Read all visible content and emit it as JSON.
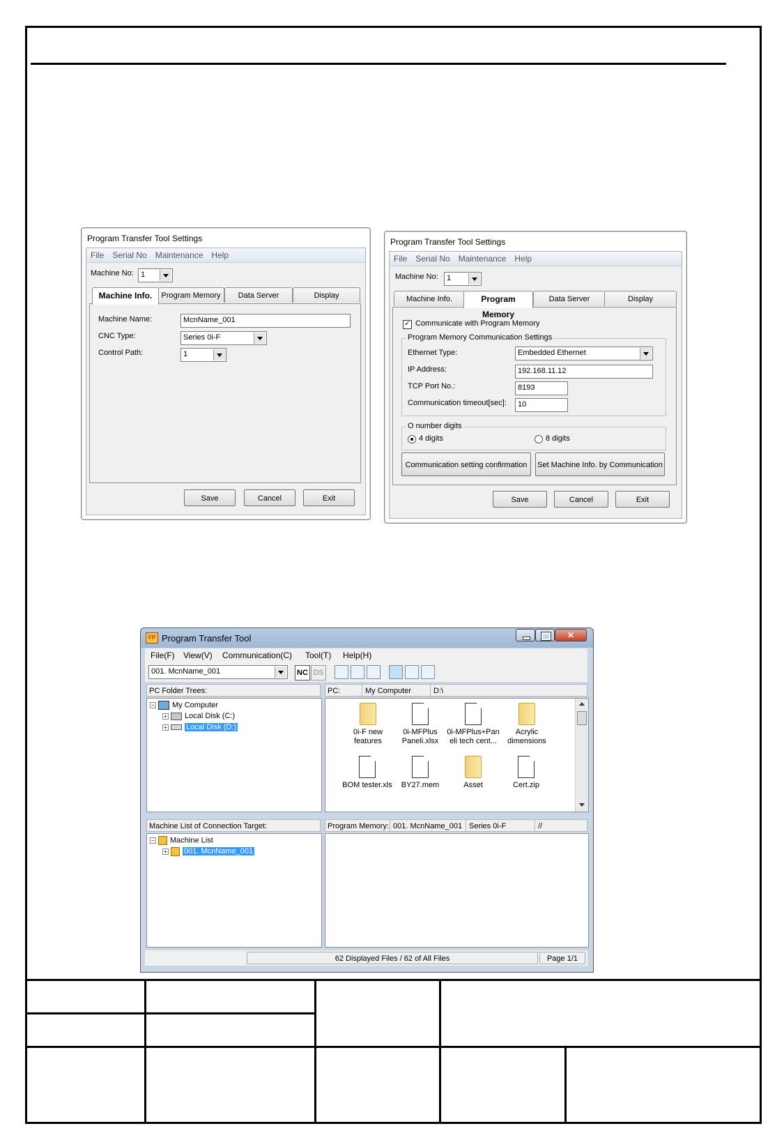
{
  "dialog_left": {
    "title": "Program Transfer Tool Settings",
    "menu": [
      "File",
      "Serial No",
      "Maintenance",
      "Help"
    ],
    "machine_no_label": "Machine No:",
    "machine_no_value": "1",
    "tabs": [
      "Machine Info.",
      "Program Memory",
      "Data Server",
      "Display"
    ],
    "machine_name_label": "Machine Name:",
    "machine_name_value": "McnName_001",
    "cnc_type_label": "CNC Type:",
    "cnc_type_value": "Series 0i-F",
    "control_path_label": "Control Path:",
    "control_path_value": "1",
    "buttons": {
      "save": "Save",
      "cancel": "Cancel",
      "exit": "Exit"
    }
  },
  "dialog_right": {
    "title": "Program Transfer Tool Settings",
    "menu": [
      "File",
      "Serial No",
      "Maintenance",
      "Help"
    ],
    "machine_no_label": "Machine No:",
    "machine_no_value": "1",
    "tabs": [
      "Machine Info.",
      "Program Memory",
      "Data Server",
      "Display"
    ],
    "communicate_label": "Communicate with Program Memory",
    "communicate_checked": true,
    "group_comm_title": "Program Memory Communication Settings",
    "ethernet_type_label": "Ethernet Type:",
    "ethernet_type_value": "Embedded Ethernet",
    "ip_label": "IP Address:",
    "ip_value": "192.168.11.12",
    "tcp_label": "TCP Port No.:",
    "tcp_value": "8193",
    "timeout_label": "Communication timeout[sec]:",
    "timeout_value": "10",
    "group_onum_title": "O number digits",
    "radio_4": "4 digits",
    "radio_8": "8 digits",
    "radio_selected": "4 digits",
    "btn_confirm": "Communication setting confirmation",
    "btn_set_info": "Set Machine Info. by Communication",
    "buttons": {
      "save": "Save",
      "cancel": "Cancel",
      "exit": "Exit"
    }
  },
  "main_window": {
    "title": "Program Transfer Tool",
    "menu": [
      "File(F)",
      "View(V)",
      "Communication(C)",
      "Tool(T)",
      "Help(H)"
    ],
    "machine_select": "001. McnName_001",
    "nc_label": "NC",
    "ds_label": "DS",
    "pc_folder_trees_label": "PC Folder Trees:",
    "pc_label": "PC:",
    "pc_location": "My Computer",
    "pc_path": "D:\\",
    "tree": {
      "root": "My Computer",
      "c": "Local Disk (C:)",
      "d": "Local Disk (D:)"
    },
    "files": [
      {
        "name": "0i-F new\nfeatures",
        "icon": "folder-icon"
      },
      {
        "name": "0i-MFPlus\nPaneli.xlsx",
        "icon": "document-icon"
      },
      {
        "name": "0i-MFPlus+Pan\neli tech cent...",
        "icon": "document-icon"
      },
      {
        "name": "Acrylic\ndimensions",
        "icon": "folder-icon"
      },
      {
        "name": "BOM tester.xls",
        "icon": "document-icon"
      },
      {
        "name": "BY27.mem",
        "icon": "document-icon"
      },
      {
        "name": "Asset",
        "icon": "folder-icon"
      },
      {
        "name": "Cert.zip",
        "icon": "document-icon"
      }
    ],
    "machine_list_label": "Machine List of Connection Target:",
    "machine_list_root": "Machine List",
    "machine_list_item": "001. McnName_001",
    "program_memory_label": "Program Memory:",
    "program_memory_machine": "001. McnName_001",
    "program_memory_series": "Series 0i-F",
    "program_memory_path": "//",
    "status_files": "62 Displayed Files / 62 of All Files",
    "status_page": "Page 1/1"
  }
}
